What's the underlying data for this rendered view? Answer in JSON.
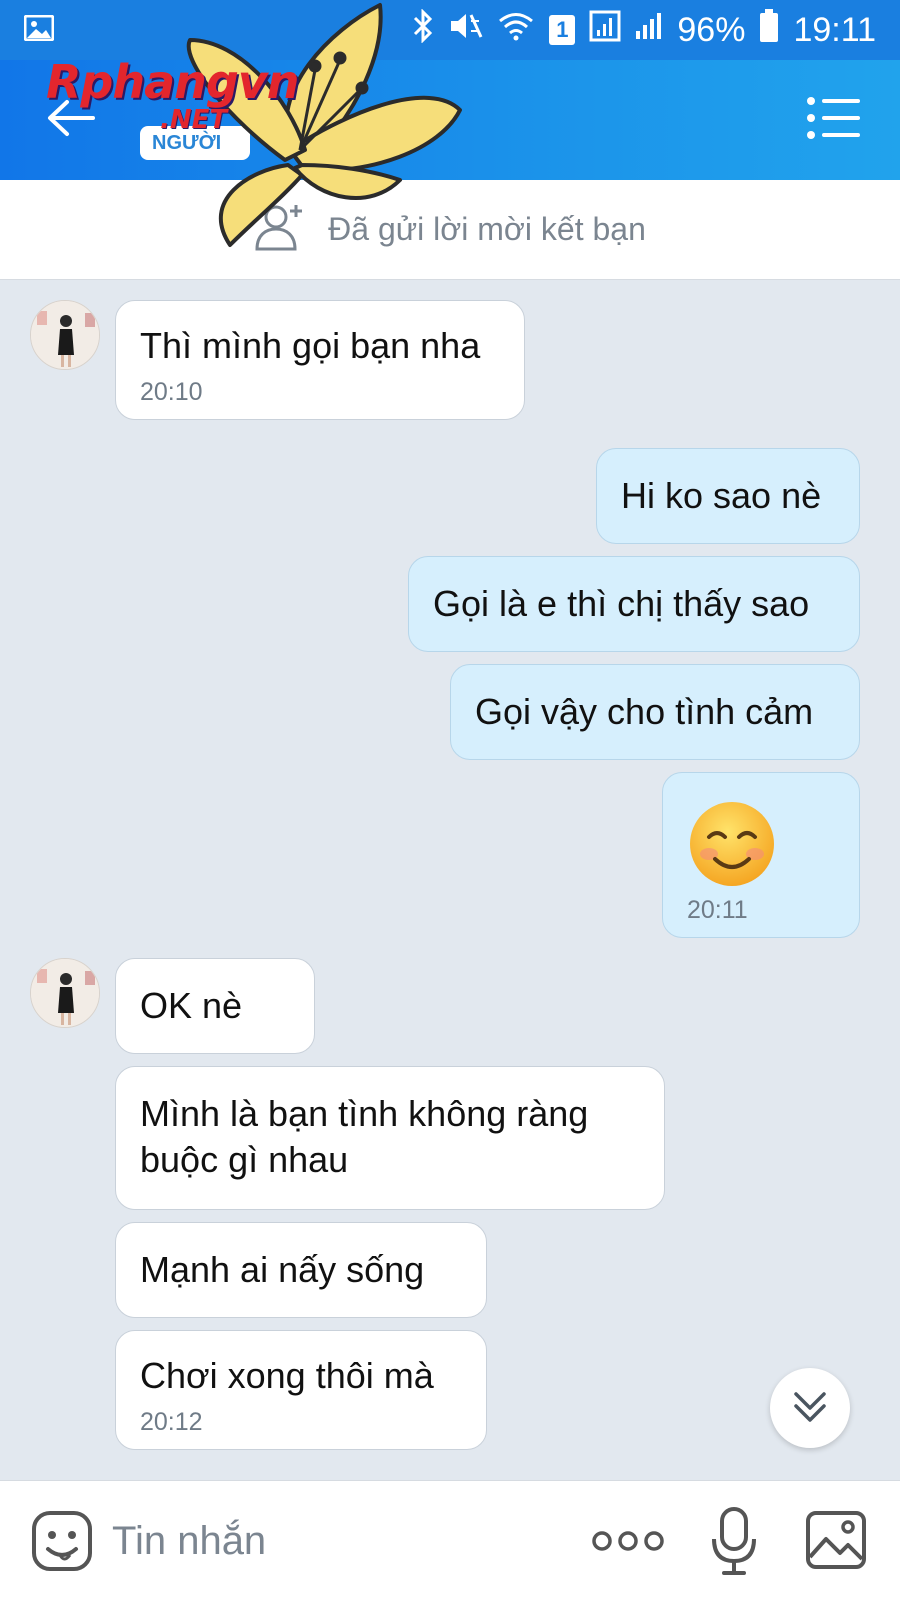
{
  "status_bar": {
    "battery_percent": "96%",
    "time": "19:11",
    "sim_slot": "1",
    "icons": [
      "gallery-icon",
      "bluetooth-icon",
      "mute-icon",
      "wifi-icon",
      "sim-signal-icon",
      "cell-signal-icon",
      "battery-icon"
    ]
  },
  "header": {
    "back_icon": "arrow-left-icon",
    "contact_badge": "NGƯỜI",
    "menu_icon": "list-menu-icon"
  },
  "watermark": {
    "brand": "Rphangvn",
    "domain": ".NET"
  },
  "friend_request": {
    "icon": "add-person-icon",
    "label": "Đã gửi lời mời kết bạn"
  },
  "messages": [
    {
      "side": "in",
      "text": "Thì mình gọi bạn nha",
      "time": "20:10"
    },
    {
      "side": "out",
      "text": "Hi ko sao nè",
      "time": ""
    },
    {
      "side": "out",
      "text": "Gọi là e thì chị thấy sao",
      "time": ""
    },
    {
      "side": "out",
      "text": "Gọi vậy cho tình cảm",
      "time": ""
    },
    {
      "side": "out",
      "emoji": "smiling-face-emoji",
      "text": "",
      "time": "20:11"
    },
    {
      "side": "in",
      "text": "OK nè",
      "time": ""
    },
    {
      "side": "in",
      "text": "Mình là bạn tình không ràng buộc gì nhau",
      "time": ""
    },
    {
      "side": "in",
      "text": "Mạnh ai nấy sống",
      "time": ""
    },
    {
      "side": "in",
      "text": "Chơi xong thôi mà",
      "time": "20:12"
    }
  ],
  "input_bar": {
    "placeholder": "Tin nhắn",
    "icons": [
      "sticker-icon",
      "more-dots-icon",
      "microphone-icon",
      "image-icon"
    ]
  },
  "colors": {
    "header_blue": "#1a7fe0",
    "chat_bg": "#e2e8ef",
    "outgoing_bubble": "#d6effd",
    "incoming_bubble": "#ffffff"
  }
}
